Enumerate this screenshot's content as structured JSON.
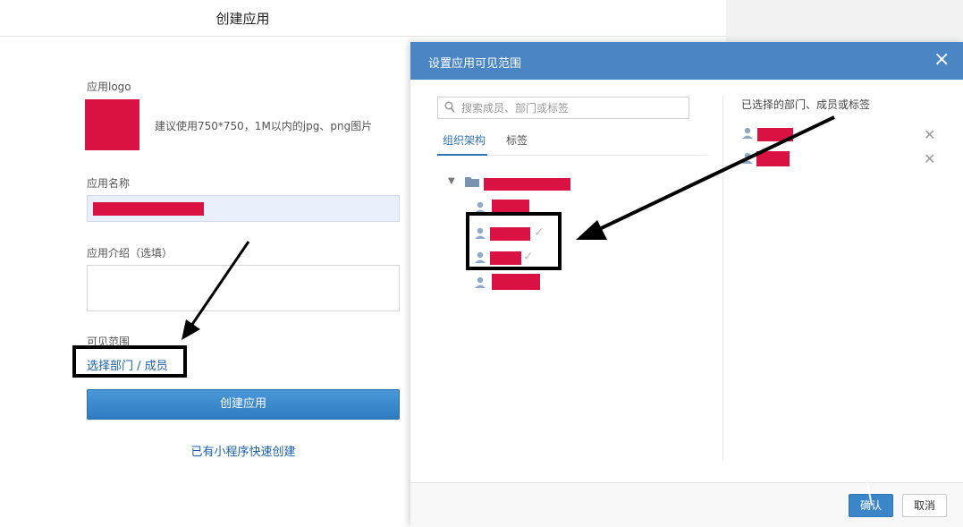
{
  "page": {
    "title": "创建应用",
    "logo_label": "应用logo",
    "logo_hint": "建议使用750*750，1M以内的jpg、png图片",
    "name_label": "应用名称",
    "intro_label": "应用介绍（选填）",
    "visibility_label": "可见范围",
    "visibility_link": "选择部门 / 成员",
    "create_button": "创建应用",
    "mini_program_link": "已有小程序快速创建"
  },
  "dialog": {
    "title": "设置应用可见范围",
    "close_icon": "×",
    "search_placeholder": "搜索成员、部门或标签",
    "tabs": [
      {
        "label": "组织架构",
        "active": true
      },
      {
        "label": "标签",
        "active": false
      }
    ],
    "tree_toggle": "▼",
    "check_mark": "✓",
    "selected_header": "已选择的部门、成员或标签",
    "remove_icon": "✕",
    "confirm_button": "确认",
    "cancel_button": "取消"
  },
  "colors": {
    "accent": "#4a86c4",
    "button_blue": "#2f7cc1",
    "link": "#1a5fa8",
    "redaction": "#da1244",
    "annotation": "#000000"
  }
}
